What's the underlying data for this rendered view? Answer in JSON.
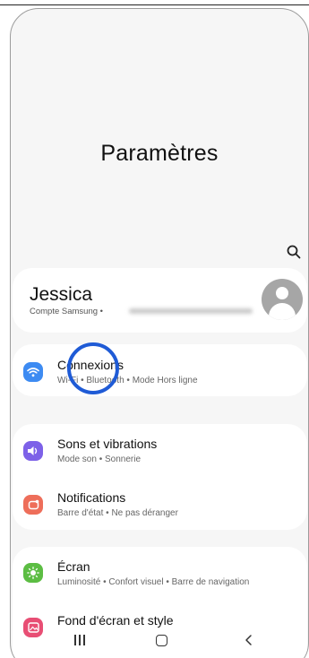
{
  "header": {
    "title": "Paramètres"
  },
  "icons": {
    "search": "search-icon",
    "avatar": "user-avatar-icon"
  },
  "profile": {
    "name": "Jessica",
    "subtitle": "Compte Samsung •"
  },
  "sections": {
    "connections": {
      "title": "Connexions",
      "subtitle": "Wi-Fi  •  Bluetooth  •  Mode Hors ligne",
      "icon": "wifi-icon",
      "color": "#3d8bf2"
    },
    "sounds": {
      "title": "Sons et vibrations",
      "subtitle": "Mode son  •  Sonnerie",
      "icon": "volume-icon",
      "color": "#7d61e8"
    },
    "notifications": {
      "title": "Notifications",
      "subtitle": "Barre d'état  •  Ne pas déranger",
      "icon": "bell-icon",
      "color": "#ee6e5a"
    },
    "screen": {
      "title": "Écran",
      "subtitle": "Luminosité  •  Confort visuel  •  Barre de navigation",
      "icon": "brightness-icon",
      "color": "#5cbd43"
    },
    "wallpaper": {
      "title": "Fond d'écran et style",
      "icon": "image-icon",
      "color": "#e84e74"
    }
  },
  "highlight": {
    "color": "#1f5bd6"
  },
  "navbar": {
    "recent": "recent-apps-icon",
    "home": "home-icon",
    "back": "back-icon"
  }
}
